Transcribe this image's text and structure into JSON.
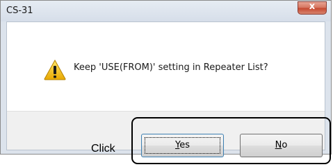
{
  "window": {
    "title": "CS-31",
    "close_symbol": "x"
  },
  "dialog": {
    "icon": "warning-icon",
    "message": "Keep 'USE(FROM)' setting in Repeater List?"
  },
  "buttons": {
    "yes": {
      "mnemonic": "Y",
      "rest": "es"
    },
    "no": {
      "mnemonic": "N",
      "rest": "o"
    }
  },
  "annotation": {
    "label": "Click"
  },
  "colors": {
    "warning": "#f5c400",
    "close": "#c5462e",
    "focus": "#3c7fb1"
  }
}
